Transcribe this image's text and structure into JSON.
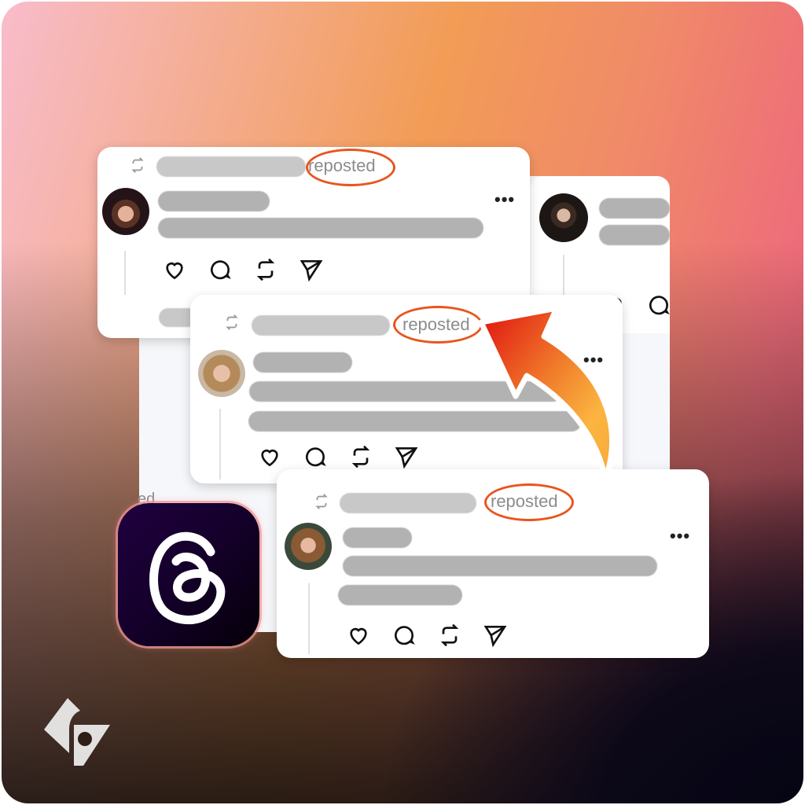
{
  "theme": {
    "accent_highlight": "#e8551f",
    "arrow_gradient": [
      "#e01010",
      "#f07a2a",
      "#fbb540"
    ],
    "threads_bg": "#14002a"
  },
  "posts": [
    {
      "id": "post-back-left",
      "label": "reposted",
      "avatar": "young man with headset",
      "actions": [
        "like-icon",
        "comment-icon",
        "repost-icon",
        "share-icon"
      ],
      "more_label": "•••"
    },
    {
      "id": "post-back-right",
      "avatar": "man with dark hair",
      "actions": [
        "like-icon",
        "comment-icon"
      ]
    },
    {
      "id": "post-middle",
      "label": "reposted",
      "avatar": "woman with blonde bob",
      "actions": [
        "like-icon",
        "comment-icon",
        "repost-icon",
        "share-icon"
      ],
      "more_label": "•••"
    },
    {
      "id": "post-front",
      "label": "reposted",
      "avatar": "woman with glasses",
      "actions": [
        "like-icon",
        "comment-icon",
        "repost-icon",
        "share-icon"
      ],
      "more_label": "•••"
    }
  ],
  "partial_text": "ed",
  "app_icon": "threads-logo-icon",
  "brand_mark": "brand-logo-icon"
}
